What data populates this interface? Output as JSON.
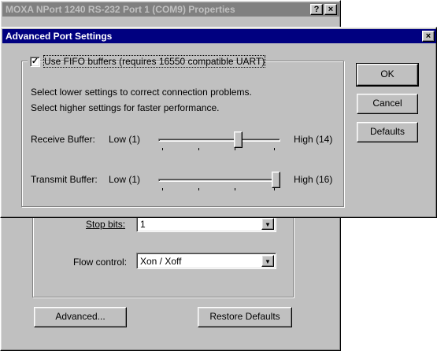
{
  "background_window": {
    "title": "MOXA NPort 1240 RS-232 Port 1 (COM9) Properties",
    "help_btn": "?",
    "close_btn": "×",
    "stop_bits_label": "Stop bits:",
    "stop_bits_value": "1",
    "flow_control_label": "Flow control:",
    "flow_control_value": "Xon / Xoff",
    "advanced_button": "Advanced...",
    "restore_defaults_button": "Restore Defaults"
  },
  "dialog": {
    "title": "Advanced Port Settings",
    "close_btn": "×",
    "use_fifo_label": "Use FIFO buffers (requires 16550 compatible UART)",
    "use_fifo_checked": true,
    "info_line1": "Select lower settings to correct connection problems.",
    "info_line2": "Select higher settings for faster performance.",
    "receive": {
      "label": "Receive Buffer:",
      "low": "Low (1)",
      "high": "High (14)",
      "position": 0.67
    },
    "transmit": {
      "label": "Transmit Buffer:",
      "low": "Low (1)",
      "high": "High (16)",
      "position": 1.0
    },
    "ok_button": "OK",
    "cancel_button": "Cancel",
    "defaults_button": "Defaults"
  }
}
